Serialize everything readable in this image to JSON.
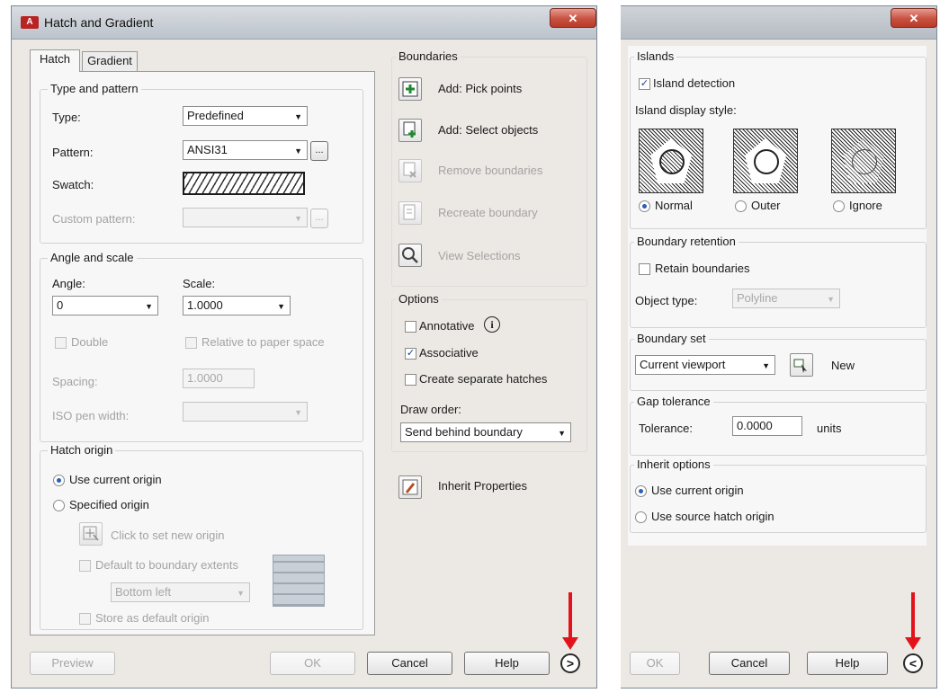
{
  "window": {
    "title": "Hatch and Gradient",
    "app_icon_text": "A",
    "close_glyph": "✕"
  },
  "tabs": [
    {
      "label": "Hatch",
      "active": true
    },
    {
      "label": "Gradient",
      "active": false
    }
  ],
  "type_and_pattern": {
    "title": "Type and pattern",
    "type_label": "Type:",
    "type_value": "Predefined",
    "pattern_label": "Pattern:",
    "pattern_value": "ANSI31",
    "browse_label": "...",
    "swatch_label": "Swatch:",
    "custom_pattern_label": "Custom pattern:",
    "custom_pattern_value": ""
  },
  "angle_and_scale": {
    "title": "Angle and scale",
    "angle_label": "Angle:",
    "angle_value": "0",
    "scale_label": "Scale:",
    "scale_value": "1.0000",
    "double_label": "Double",
    "relative_label": "Relative to paper space",
    "spacing_label": "Spacing:",
    "spacing_value": "1.0000",
    "iso_pen_label": "ISO pen width:",
    "iso_pen_value": ""
  },
  "hatch_origin": {
    "title": "Hatch origin",
    "use_current_label": "Use current origin",
    "specified_label": "Specified origin",
    "click_to_set_label": "Click to set new origin",
    "default_extents_label": "Default to boundary extents",
    "position_value": "Bottom left",
    "store_default_label": "Store as default origin"
  },
  "boundaries": {
    "title": "Boundaries",
    "add_pick_points": "Add: Pick points",
    "add_select_objects": "Add: Select objects",
    "remove_boundaries": "Remove boundaries",
    "recreate_boundary": "Recreate boundary",
    "view_selections": "View Selections"
  },
  "options": {
    "title": "Options",
    "annotative_label": "Annotative",
    "info_glyph": "i",
    "associative_label": "Associative",
    "create_separate_label": "Create separate hatches",
    "draw_order_label": "Draw order:",
    "draw_order_value": "Send behind boundary"
  },
  "inherit_properties": "Inherit Properties",
  "bottom_left": {
    "preview": "Preview",
    "ok": "OK",
    "cancel": "Cancel",
    "help": "Help",
    "expand_glyph": ">"
  },
  "islands": {
    "title": "Islands",
    "island_detection_label": "Island detection",
    "display_style_label": "Island display style:",
    "normal_label": "Normal",
    "outer_label": "Outer",
    "ignore_label": "Ignore"
  },
  "boundary_retention": {
    "title": "Boundary retention",
    "retain_label": "Retain boundaries",
    "object_type_label": "Object type:",
    "object_type_value": "Polyline"
  },
  "boundary_set": {
    "title": "Boundary set",
    "value": "Current viewport",
    "new_label": "New"
  },
  "gap_tolerance": {
    "title": "Gap tolerance",
    "tolerance_label": "Tolerance:",
    "tolerance_value": "0.0000",
    "units_label": "units"
  },
  "inherit_options": {
    "title": "Inherit options",
    "use_current_label": "Use current origin",
    "use_source_label": "Use source hatch origin"
  },
  "bottom_right": {
    "ok": "OK",
    "cancel": "Cancel",
    "help": "Help",
    "collapse_glyph": "<"
  },
  "colors": {
    "accent_arrow": "#e3131b",
    "close_button": "#c8513f"
  }
}
